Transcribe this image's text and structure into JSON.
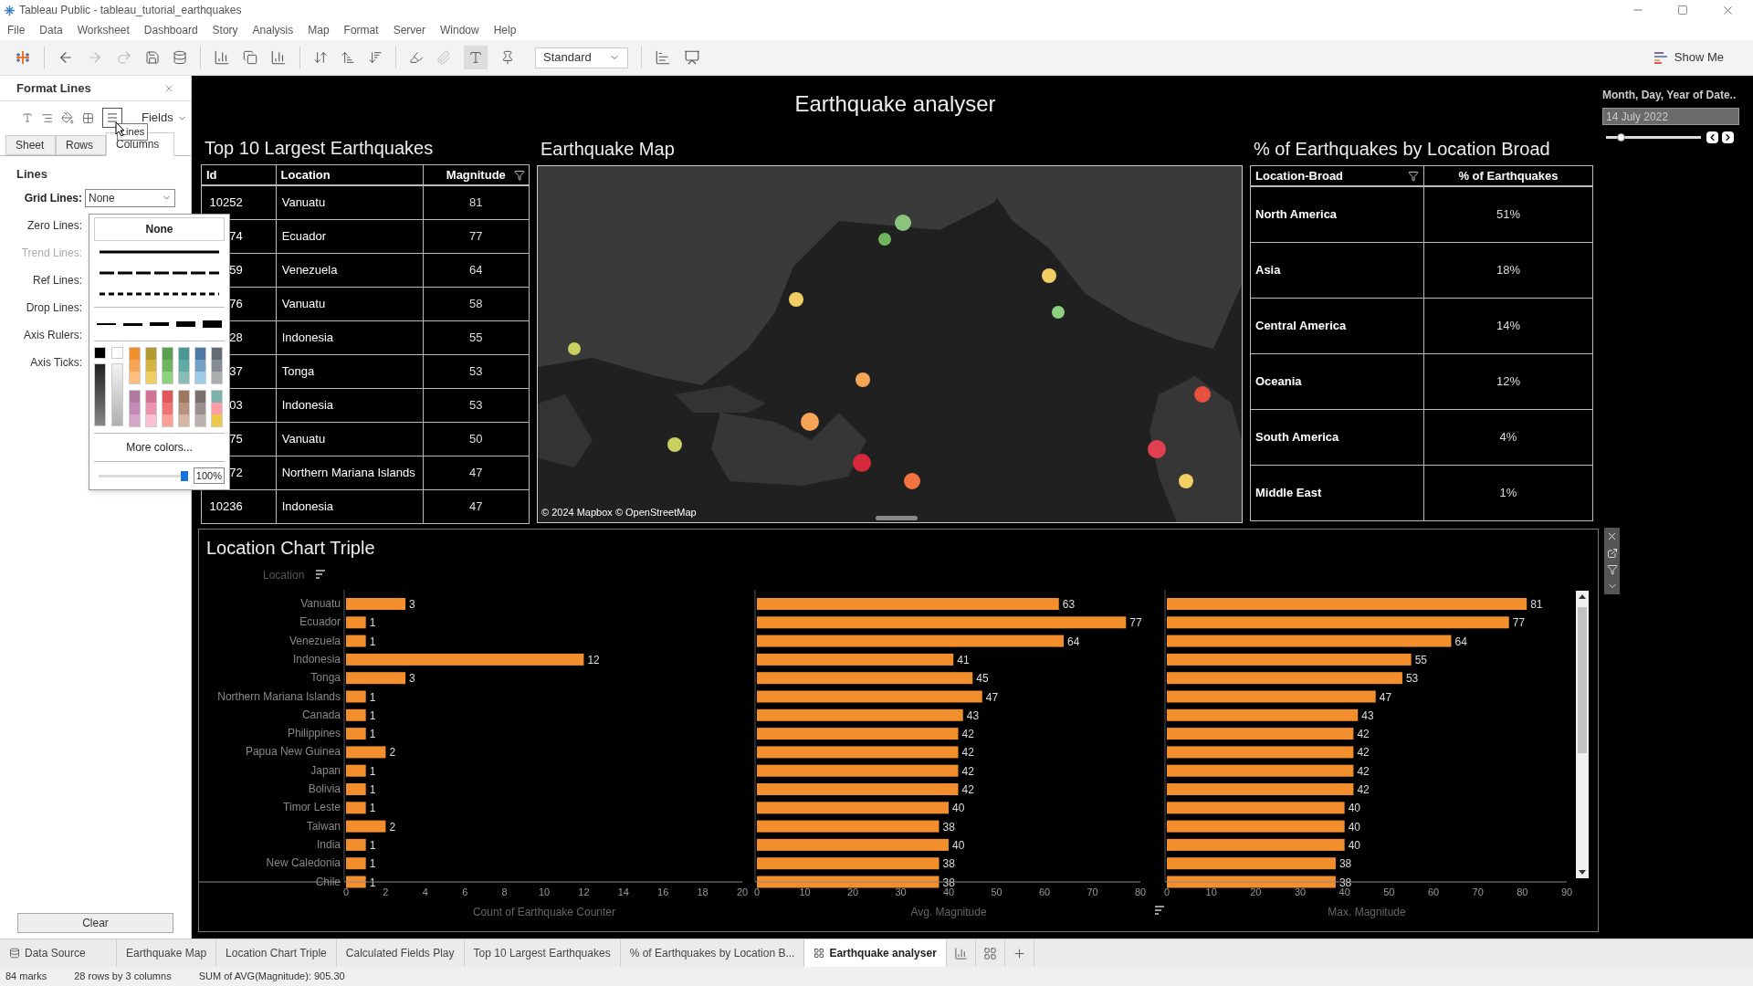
{
  "window": {
    "title": "Tableau Public - tableau_tutorial_earthquakes"
  },
  "menu": [
    "File",
    "Data",
    "Worksheet",
    "Dashboard",
    "Story",
    "Analysis",
    "Map",
    "Format",
    "Server",
    "Window",
    "Help"
  ],
  "toolbar": {
    "view_select": "Standard",
    "show_me": "Show Me"
  },
  "format_panel": {
    "title": "Format Lines",
    "fields_button": "Fields",
    "tooltip": "Lines",
    "tabs": [
      {
        "label": "Sheet",
        "selected": false
      },
      {
        "label": "Rows",
        "selected": false
      },
      {
        "label": "Columns",
        "selected": true
      }
    ],
    "section": "Lines",
    "rows": [
      {
        "label": "Grid Lines:",
        "kind": "select",
        "value": "None",
        "disabled": false
      },
      {
        "label": "Zero Lines:",
        "kind": "label",
        "disabled": false
      },
      {
        "label": "Trend Lines:",
        "kind": "label",
        "disabled": true
      },
      {
        "label": "Ref Lines:",
        "kind": "label",
        "disabled": false
      },
      {
        "label": "Drop Lines:",
        "kind": "label",
        "disabled": false
      },
      {
        "label": "Axis Rulers:",
        "kind": "label",
        "disabled": false
      },
      {
        "label": "Axis Ticks:",
        "kind": "label",
        "disabled": false
      }
    ],
    "clear_button": "Clear"
  },
  "line_popup": {
    "none_option": "None",
    "more_colors": "More colors...",
    "opacity": {
      "level": 1,
      "reading": "100%"
    }
  },
  "dashboard": {
    "title": "Earthquake analyser",
    "top10": {
      "title": "Top 10 Largest Earthquakes",
      "columns": [
        "Id",
        "Location",
        "Magnitude"
      ],
      "rows": [
        [
          "10252",
          "Vanuatu",
          "81"
        ],
        [
          "74",
          "Ecuador",
          "77"
        ],
        [
          "59",
          "Venezuela",
          "64"
        ],
        [
          "76",
          "Vanuatu",
          "58"
        ],
        [
          "28",
          "Indonesia",
          "55"
        ],
        [
          "37",
          "Tonga",
          "53"
        ],
        [
          "03",
          "Indonesia",
          "53"
        ],
        [
          "75",
          "Vanuatu",
          "50"
        ],
        [
          "72",
          "Northern Mariana Islands",
          "47"
        ],
        [
          "10236",
          "Indonesia",
          "47"
        ]
      ]
    },
    "map": {
      "title": "Earthquake Map",
      "attribution": "© 2024 Mapbox © OpenStreetMap"
    },
    "by_location": {
      "title": "% of Earthquakes by Location Broad",
      "columns": [
        "Location-Broad",
        "% of Earthquakes"
      ],
      "rows": [
        [
          "North America",
          "51%"
        ],
        [
          "Asia",
          "18%"
        ],
        [
          "Central America",
          "14%"
        ],
        [
          "Oceania",
          "12%"
        ],
        [
          "South America",
          "4%"
        ],
        [
          "Middle East",
          "1%"
        ]
      ]
    },
    "date_filter": {
      "label": "Month, Day, Year of Date..",
      "value": "14 July 2022",
      "level": 0.15
    },
    "location_chart": {
      "title": "Location Chart Triple",
      "row_header": "Location",
      "panels": [
        {
          "chart_data": {
            "type": "bar",
            "orientation": "horizontal",
            "categories": [
              "Vanuatu",
              "Ecuador",
              "Venezuela",
              "Indonesia",
              "Tonga",
              "Northern Mariana Islands",
              "Canada",
              "Philippines",
              "Papua New Guinea",
              "Japan",
              "Bolivia",
              "Timor Leste",
              "Taiwan",
              "India",
              "New Caledonia",
              "Chile"
            ],
            "xlim": [
              0,
              20
            ],
            "xticks": [
              0,
              2,
              4,
              6,
              8,
              10,
              12,
              14,
              16,
              18,
              20
            ],
            "data_labels": true,
            "series": [
              {
                "name": "Count of Earthquake Counter",
                "color": "#f28e2b",
                "values": [
                  3,
                  1,
                  1,
                  12,
                  3,
                  1,
                  1,
                  1,
                  2,
                  1,
                  1,
                  1,
                  2,
                  1,
                  1,
                  1
                ]
              }
            ]
          }
        },
        {
          "chart_data": {
            "type": "bar",
            "orientation": "horizontal",
            "xlim": [
              0,
              80
            ],
            "xticks": [
              0,
              10,
              20,
              30,
              40,
              50,
              60,
              70,
              80
            ],
            "data_labels": true,
            "series": [
              {
                "name": "Avg. Magnitude",
                "color": "#f28e2b",
                "values": [
                  63,
                  77,
                  64,
                  41,
                  45,
                  47,
                  43,
                  42,
                  42,
                  42,
                  42,
                  40,
                  38,
                  40,
                  38,
                  38
                ]
              }
            ]
          }
        },
        {
          "chart_data": {
            "type": "bar",
            "orientation": "horizontal",
            "xlim": [
              0,
              90
            ],
            "xticks": [
              0,
              10,
              20,
              30,
              40,
              50,
              60,
              70,
              80,
              90
            ],
            "data_labels": true,
            "series": [
              {
                "name": "Max. Magnitude",
                "color": "#f28e2b",
                "values": [
                  81,
                  77,
                  64,
                  55,
                  53,
                  47,
                  43,
                  42,
                  42,
                  42,
                  42,
                  40,
                  40,
                  40,
                  38,
                  38
                ]
              }
            ]
          }
        }
      ]
    }
  },
  "sheet_tabs": [
    {
      "label": "Data Source",
      "kind": "data",
      "selected": false
    },
    {
      "label": "Earthquake Map",
      "kind": "sheet",
      "selected": false
    },
    {
      "label": "Location Chart Triple",
      "kind": "sheet",
      "selected": false
    },
    {
      "label": "Calculated Fields Play",
      "kind": "sheet",
      "selected": false
    },
    {
      "label": "Top 10 Largest Earthquakes",
      "kind": "sheet",
      "selected": false
    },
    {
      "label": "% of Earthquakes by Location B...",
      "kind": "sheet",
      "selected": false
    },
    {
      "label": "Earthquake analyser",
      "kind": "dashboard",
      "selected": true
    }
  ],
  "status_bar": [
    "84 marks",
    "28 rows by 3 columns",
    "SUM of AVG(Magnitude): 905.30"
  ]
}
